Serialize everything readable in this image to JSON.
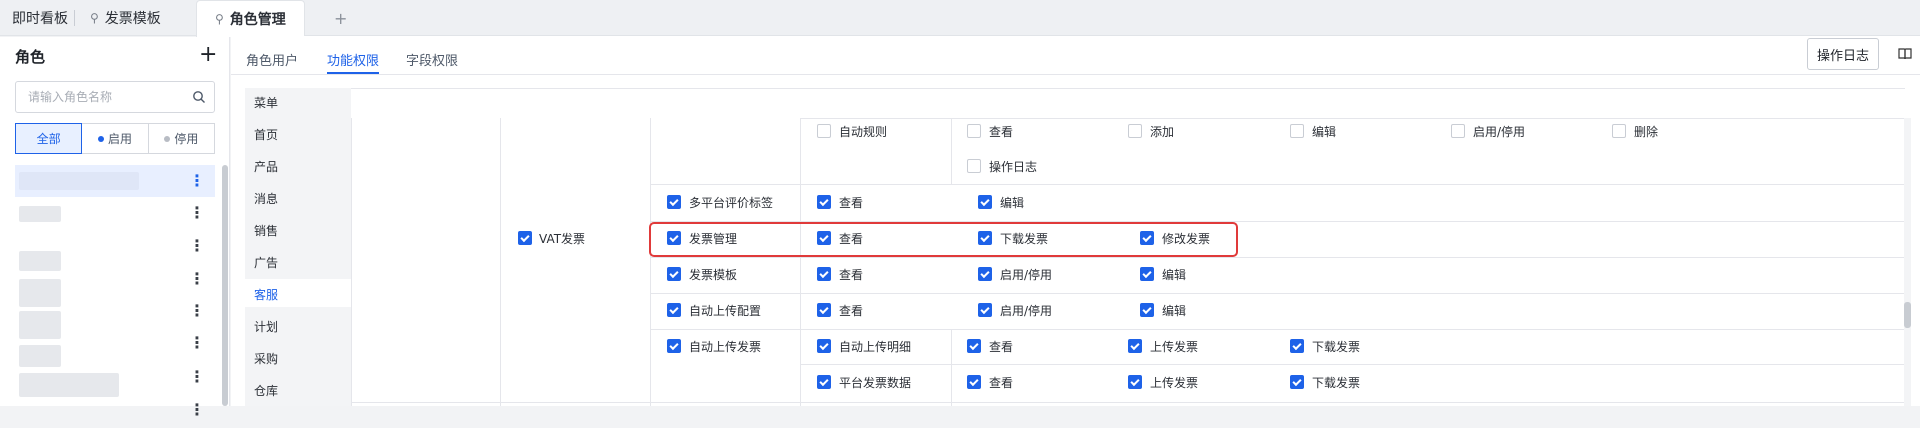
{
  "tabs": [
    {
      "label": "即时看板",
      "pinned": false,
      "active": false
    },
    {
      "label": "发票模板",
      "pinned": true,
      "active": false
    },
    {
      "label": "角色管理",
      "pinned": true,
      "active": true
    }
  ],
  "tab_add": "+",
  "sidebar": {
    "title": "角色",
    "add": "+",
    "search_placeholder": "请输入角色名称",
    "filters": [
      {
        "label": "全部",
        "dot_color": null,
        "active": true
      },
      {
        "label": "启用",
        "dot_color": "#1e62e8",
        "active": false
      },
      {
        "label": "停用",
        "dot_color": "#b8bcc4",
        "active": false
      }
    ],
    "more": "⋮"
  },
  "subtabs": [
    "角色用户",
    "功能权限",
    "字段权限"
  ],
  "active_subtab": 1,
  "operation_log": "操作日志",
  "menu": [
    "菜单",
    "首页",
    "产品",
    "消息",
    "销售",
    "广告",
    "客服",
    "计划",
    "采购",
    "仓库"
  ],
  "active_menu": 6,
  "group": {
    "label": "VAT发票",
    "checked": true
  },
  "perm_rows": [
    {
      "label": "",
      "checked": null,
      "items": [
        {
          "label": "自动规则",
          "checked": false
        },
        {
          "label": "查看",
          "checked": false
        },
        {
          "label": "添加",
          "checked": false
        },
        {
          "label": "编辑",
          "checked": false
        },
        {
          "label": "启用/停用",
          "checked": false
        },
        {
          "label": "删除",
          "checked": false
        }
      ]
    },
    {
      "label": "",
      "checked": null,
      "items": [
        {
          "label": "操作日志",
          "checked": false
        }
      ]
    },
    {
      "label": "多平台评价标签",
      "checked": true,
      "items": [
        {
          "label": "查看",
          "checked": true
        },
        {
          "label": "编辑",
          "checked": true
        }
      ]
    },
    {
      "label": "发票管理",
      "checked": true,
      "items": [
        {
          "label": "查看",
          "checked": true
        },
        {
          "label": "下载发票",
          "checked": true
        },
        {
          "label": "修改发票",
          "checked": true
        }
      ]
    },
    {
      "label": "发票模板",
      "checked": true,
      "items": [
        {
          "label": "查看",
          "checked": true
        },
        {
          "label": "启用/停用",
          "checked": true
        },
        {
          "label": "编辑",
          "checked": true
        }
      ]
    },
    {
      "label": "自动上传配置",
      "checked": true,
      "items": [
        {
          "label": "查看",
          "checked": true
        },
        {
          "label": "启用/停用",
          "checked": true
        },
        {
          "label": "编辑",
          "checked": true
        }
      ]
    },
    {
      "label": "自动上传发票",
      "checked": true,
      "items": [
        {
          "label": "自动上传明细",
          "checked": true
        },
        {
          "label": "查看",
          "checked": true
        },
        {
          "label": "上传发票",
          "checked": true
        },
        {
          "label": "下载发票",
          "checked": true
        }
      ]
    },
    {
      "label": "",
      "checked": null,
      "items": [
        {
          "label": "平台发票数据",
          "checked": true
        },
        {
          "label": "查看",
          "checked": true
        },
        {
          "label": "上传发票",
          "checked": true
        },
        {
          "label": "下载发票",
          "checked": true
        }
      ]
    }
  ],
  "colors": {
    "accent": "#1e62e8",
    "highlight": "#e03a3a"
  }
}
